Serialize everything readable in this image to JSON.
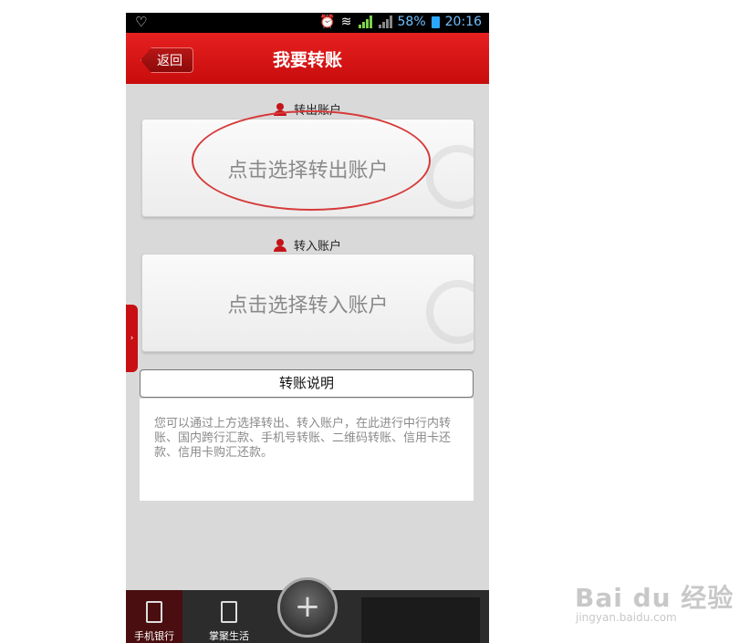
{
  "status_bar": {
    "left_icon": "v-shield-icon",
    "battery": "58%",
    "time": "20:16"
  },
  "header": {
    "back": "返回",
    "title": "我要转账"
  },
  "from_section": {
    "label": "转出账户",
    "placeholder": "点击选择转出账户"
  },
  "to_section": {
    "label": "转入账户",
    "placeholder": "点击选择转入账户"
  },
  "info": {
    "title": "转账说明",
    "body": "您可以通过上方选择转出、转入账户，在此进行中行内转账、国内跨行汇款、手机号转账、二维码转账、信用卡还款、信用卡购汇还款。"
  },
  "bottom_nav": {
    "tab1": "手机银行",
    "tab2": "掌聚生活",
    "center_icon": "+"
  },
  "watermark": {
    "logo": "Bai du 经验",
    "url": "jingyan.baidu.com"
  },
  "colors": {
    "header_red": "#d81414",
    "annotation_red": "#d73a3a",
    "background": "#d9d9d9"
  }
}
